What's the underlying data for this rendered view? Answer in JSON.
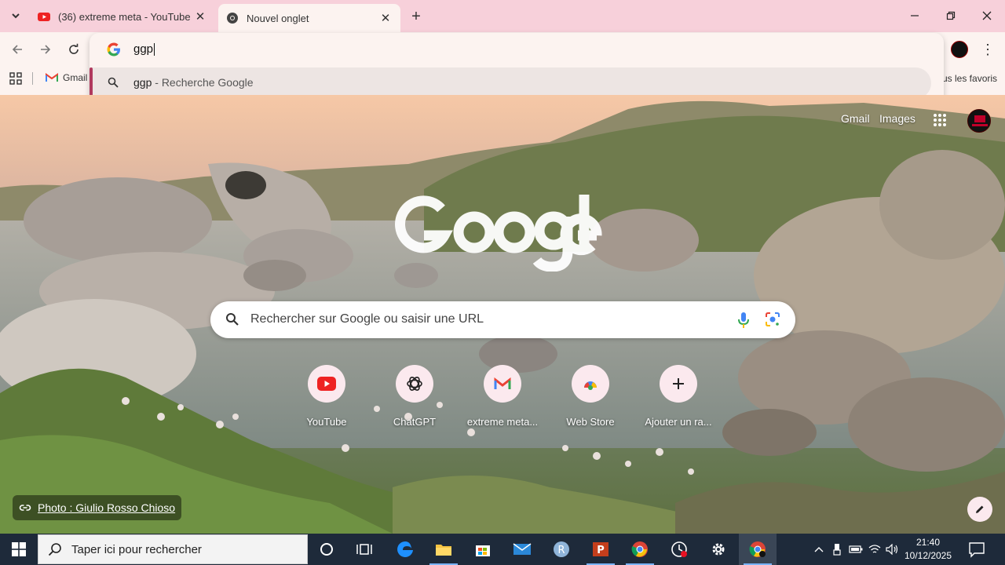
{
  "browser": {
    "tabs": [
      {
        "title": "(36) extreme meta - YouTube",
        "favicon": "youtube-icon",
        "active": false
      },
      {
        "title": "Nouvel onglet",
        "favicon": "chrome-icon",
        "active": true
      }
    ],
    "omnibox": {
      "value": "ggp",
      "suggestion_query": "ggp",
      "suggestion_separator": " - ",
      "suggestion_source": "Recherche Google"
    },
    "bookmarks": {
      "gmail_label": "Gmail",
      "all_bookmarks_label": "us les favoris"
    }
  },
  "ntp": {
    "header_links": {
      "gmail": "Gmail",
      "images": "Images"
    },
    "search_placeholder": "Rechercher sur Google ou saisir une URL",
    "shortcuts": [
      {
        "label": "YouTube",
        "icon": "youtube-icon"
      },
      {
        "label": "ChatGPT",
        "icon": "chatgpt-icon"
      },
      {
        "label": "extreme meta...",
        "icon": "gmail-icon"
      },
      {
        "label": "Web Store",
        "icon": "webstore-icon"
      },
      {
        "label": "Ajouter un ra...",
        "icon": "plus-icon"
      }
    ],
    "photo_credit": "Photo : Giulio Rosso Chioso"
  },
  "taskbar": {
    "search_placeholder": "Taper ici pour rechercher",
    "time": "21:40",
    "date": "10/12/2025"
  },
  "colors": {
    "tabstrip": "#f7d0da",
    "toolbar": "#fcf3f0",
    "suggestion_accent": "#b0395e",
    "taskbar": "#1e2a3a"
  }
}
